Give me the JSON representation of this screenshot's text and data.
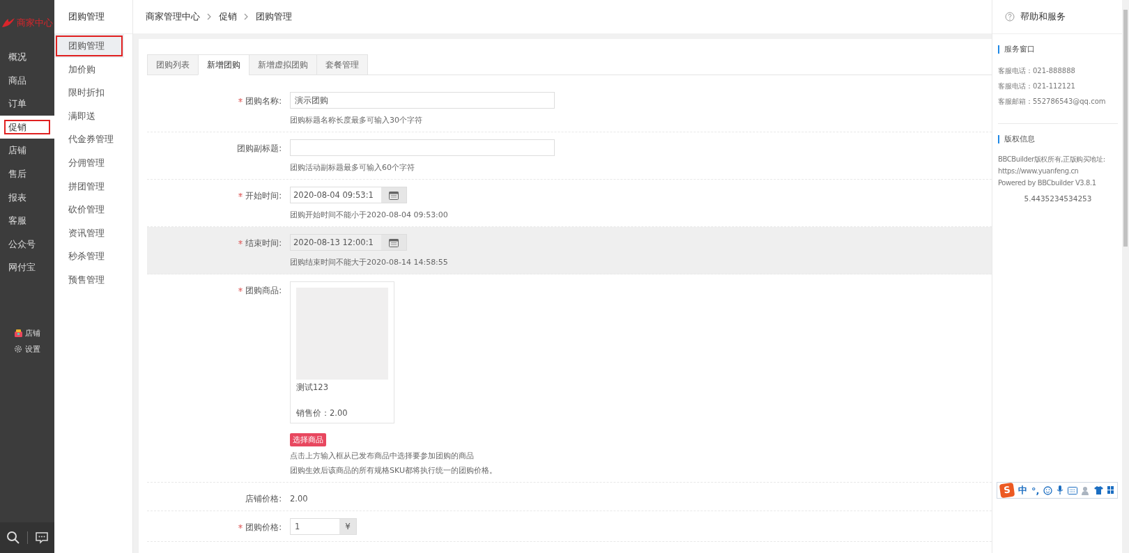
{
  "brand": {
    "name": "商家中心"
  },
  "main_nav": [
    {
      "label": "概况",
      "selected": false
    },
    {
      "label": "商品",
      "selected": false
    },
    {
      "label": "订单",
      "selected": false
    },
    {
      "label": "促销",
      "selected": true
    },
    {
      "label": "店铺",
      "selected": false
    },
    {
      "label": "售后",
      "selected": false
    },
    {
      "label": "报表",
      "selected": false
    },
    {
      "label": "客服",
      "selected": false
    },
    {
      "label": "公众号",
      "selected": false
    },
    {
      "label": "网付宝",
      "selected": false
    }
  ],
  "nav_footer": [
    {
      "kind": "shop",
      "label": "店铺"
    },
    {
      "kind": "settings",
      "label": "设置"
    }
  ],
  "sub_nav": {
    "title": "团购管理",
    "items": [
      {
        "label": "团购管理",
        "selected": true
      },
      {
        "label": "加价购",
        "selected": false
      },
      {
        "label": "限时折扣",
        "selected": false
      },
      {
        "label": "满即送",
        "selected": false
      },
      {
        "label": "代金券管理",
        "selected": false
      },
      {
        "label": "分佣管理",
        "selected": false
      },
      {
        "label": "拼团管理",
        "selected": false
      },
      {
        "label": "砍价管理",
        "selected": false
      },
      {
        "label": "资讯管理",
        "selected": false
      },
      {
        "label": "秒杀管理",
        "selected": false
      },
      {
        "label": "预售管理",
        "selected": false
      }
    ]
  },
  "breadcrumb": [
    "商家管理中心",
    "促销",
    "团购管理"
  ],
  "tabs": [
    {
      "label": "团购列表",
      "selected": false
    },
    {
      "label": "新增团购",
      "selected": true
    },
    {
      "label": "新增虚拟团购",
      "selected": false
    },
    {
      "label": "套餐管理",
      "selected": false
    }
  ],
  "form": [
    {
      "kind": "text",
      "label": "团购名称:",
      "required": true,
      "highlighted": false,
      "value": "演示团购",
      "hint": "团购标题名称长度最多可输入30个字符"
    },
    {
      "kind": "text",
      "label": "团购副标题:",
      "required": false,
      "highlighted": false,
      "hint": "团购活动副标题最多可输入60个字符"
    },
    {
      "kind": "datetime",
      "label": "开始时间:",
      "required": true,
      "highlighted": false,
      "value": "2020-08-04 09:53:1",
      "hint": "团购开始时间不能小于2020-08-04 09:53:00"
    },
    {
      "kind": "datetime",
      "label": "结束时间:",
      "required": true,
      "highlighted": true,
      "value": "2020-08-13 12:00:1",
      "hint": "团购结束时间不能大于2020-08-14 14:58:55"
    },
    {
      "kind": "product",
      "label": "团购商品:",
      "required": true,
      "highlighted": false,
      "product": {
        "name": "测试123",
        "price": "销售价：2.00"
      },
      "button": "选择商品",
      "hints": [
        "点击上方输入框从已发布商品中选择要参加团购的商品",
        "团购生效后该商品的所有规格SKU都将执行统一的团购价格。"
      ]
    },
    {
      "kind": "static",
      "label": "店铺价格:",
      "required": false,
      "highlighted": false,
      "value": "2.00"
    },
    {
      "kind": "price",
      "label": "团购价格:",
      "required": true,
      "highlighted": false,
      "value": "1",
      "unit": "¥"
    }
  ],
  "help": {
    "title": "帮助和服务",
    "sections": [
      {
        "title": "服务窗口",
        "lines": [
          "客服电话：021-888888",
          "客服电话：021-112121",
          "客服邮箱：552786543@qq.com"
        ]
      },
      {
        "title": "版权信息",
        "lines": [
          "BBCBuilder版权所有,正版购买地址:",
          "https://www.yuanfeng.cn",
          "Powered by BBCbuilder V3.8.1"
        ],
        "footer": "5.4435234534253"
      }
    ]
  },
  "ime_toolbar": {
    "logo": "S",
    "mode": "中",
    "punct": "°,"
  }
}
